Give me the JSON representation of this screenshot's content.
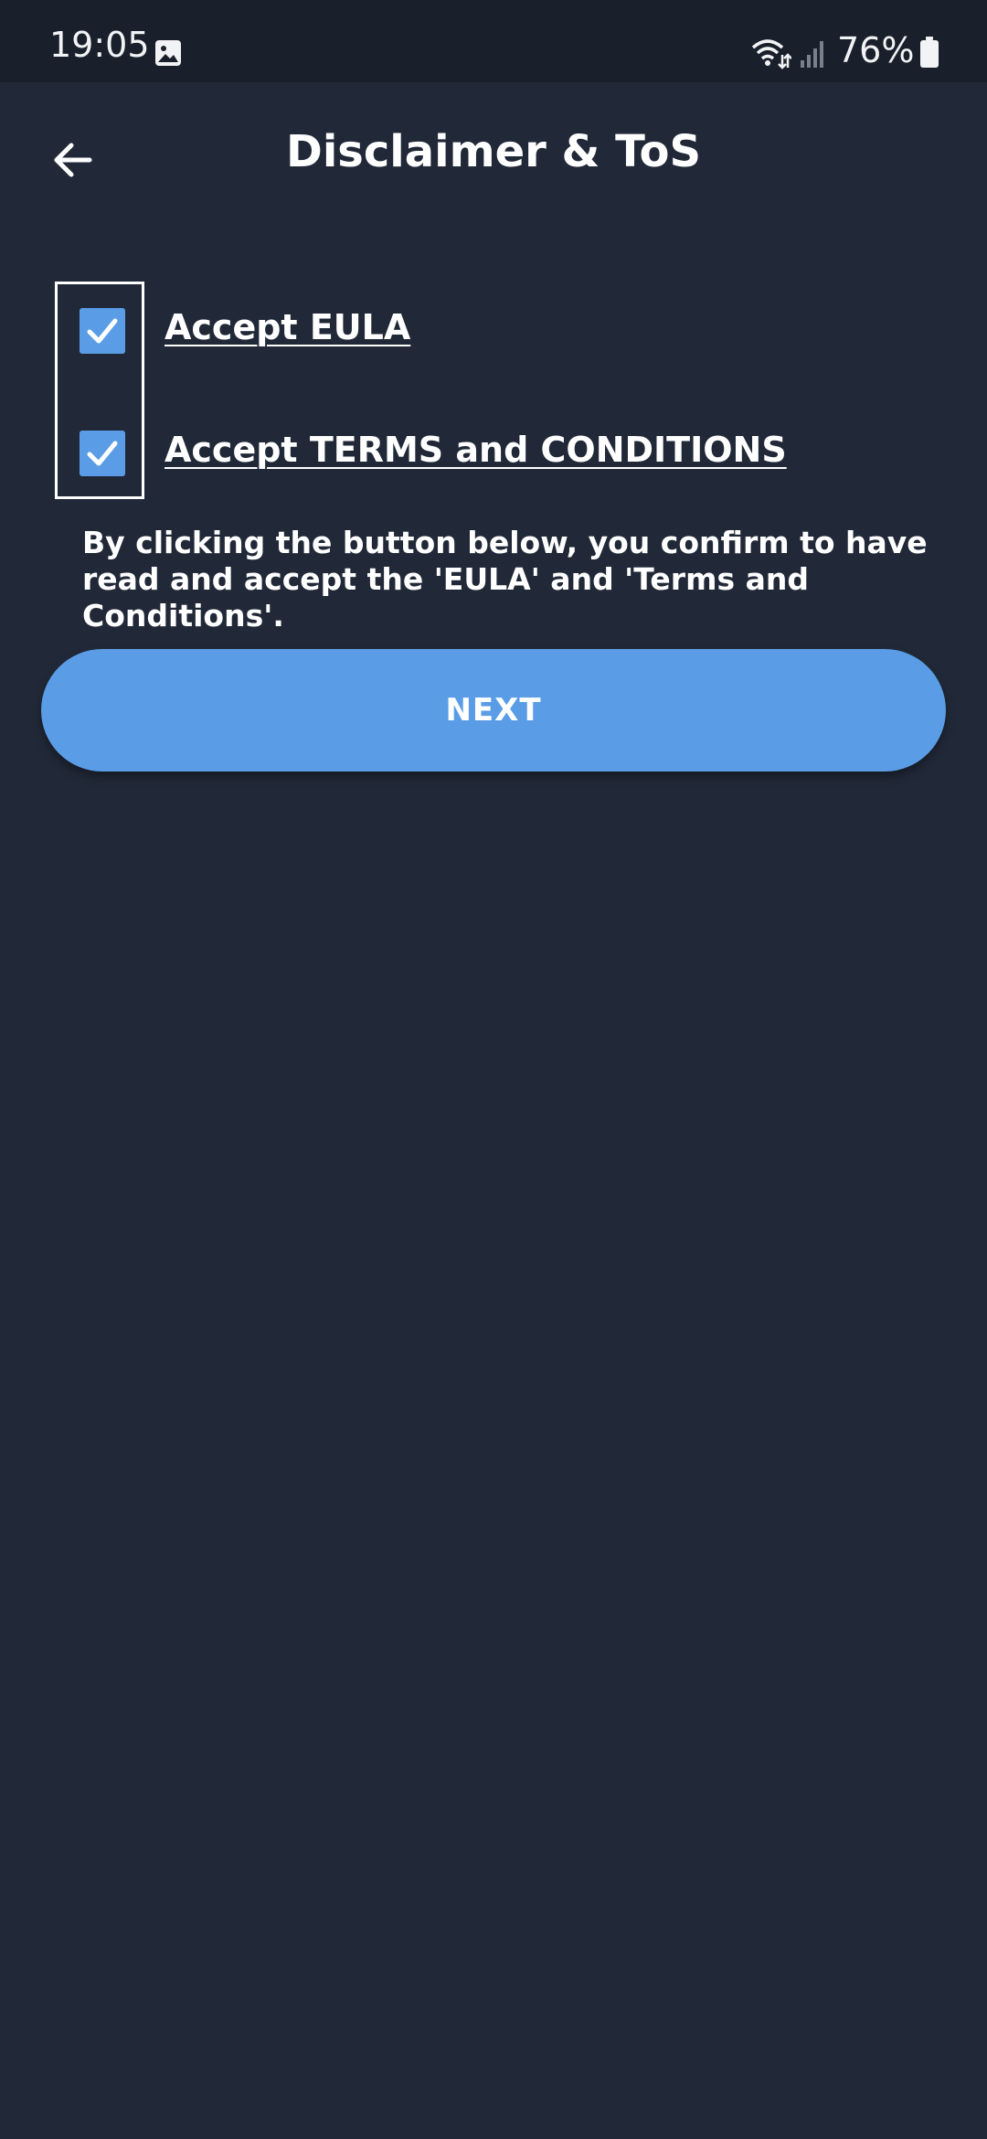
{
  "status_bar": {
    "time": "19:05",
    "battery_percent": "76%",
    "icons": [
      "gallery-icon",
      "wifi-icon",
      "signal-icon",
      "battery-icon"
    ]
  },
  "header": {
    "title": "Disclaimer & ToS",
    "back_icon": "arrow-left-icon"
  },
  "agreements": [
    {
      "label": "Accept EULA",
      "checked": true
    },
    {
      "label": "Accept TERMS and CONDITIONS",
      "checked": true
    }
  ],
  "confirm_text": "By clicking the button below, you confirm to have read and accept the 'EULA' and 'Terms and Conditions'.",
  "next_button": {
    "label": "NEXT"
  },
  "colors": {
    "background": "#212938",
    "status_bar": "#1a202b",
    "accent": "#5a9de6",
    "text": "#ffffff"
  }
}
